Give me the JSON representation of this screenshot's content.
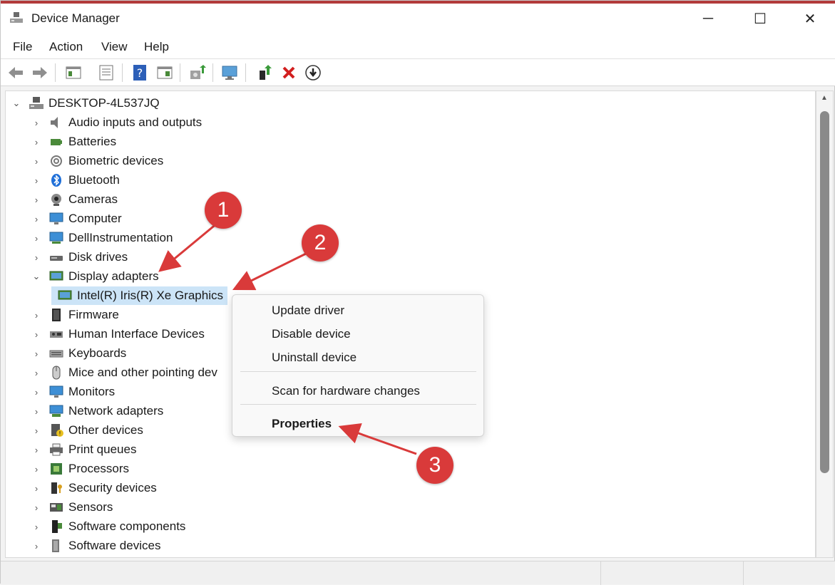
{
  "window": {
    "title": "Device Manager",
    "minimize_glyph": "─",
    "maximize_glyph": "☐",
    "close_glyph": "✕",
    "accent_color": "#d93a3a",
    "selection_color": "#cce4f7"
  },
  "menu": {
    "file": "File",
    "action": "Action",
    "view": "View",
    "help": "Help"
  },
  "toolbar": {
    "icons": [
      "back-arrow-icon",
      "forward-arrow-icon",
      "show-hide-tree-icon",
      "properties-icon",
      "help-icon",
      "action-pane-icon",
      "update-driver-icon",
      "scan-hardware-icon",
      "enable-device-icon",
      "uninstall-icon",
      "download-icon"
    ]
  },
  "tree": {
    "root": "DESKTOP-4L537JQ",
    "items": [
      {
        "label": "Audio inputs and outputs",
        "icon": "speaker-icon"
      },
      {
        "label": "Batteries",
        "icon": "battery-icon"
      },
      {
        "label": "Biometric devices",
        "icon": "fingerprint-icon"
      },
      {
        "label": "Bluetooth",
        "icon": "bluetooth-icon"
      },
      {
        "label": "Cameras",
        "icon": "camera-icon"
      },
      {
        "label": "Computer",
        "icon": "computer-icon"
      },
      {
        "label": "DellInstrumentation",
        "icon": "network-monitor-icon"
      },
      {
        "label": "Disk drives",
        "icon": "disk-drive-icon"
      },
      {
        "label": "Display adapters",
        "icon": "display-adapter-icon"
      },
      {
        "label": "Intel(R) Iris(R) Xe Graphics",
        "icon": "display-adapter-icon"
      },
      {
        "label": "Firmware",
        "icon": "chip-icon"
      },
      {
        "label": "Human Interface Devices",
        "icon": "hid-icon"
      },
      {
        "label": "Keyboards",
        "icon": "keyboard-icon"
      },
      {
        "label": "Mice and other pointing dev",
        "icon": "mouse-icon"
      },
      {
        "label": "Monitors",
        "icon": "monitor-icon"
      },
      {
        "label": "Network adapters",
        "icon": "network-adapter-icon"
      },
      {
        "label": "Other devices",
        "icon": "unknown-device-icon"
      },
      {
        "label": "Print queues",
        "icon": "printer-icon"
      },
      {
        "label": "Processors",
        "icon": "processor-icon"
      },
      {
        "label": "Security devices",
        "icon": "security-key-icon"
      },
      {
        "label": "Sensors",
        "icon": "sensor-icon"
      },
      {
        "label": "Software components",
        "icon": "software-component-icon"
      },
      {
        "label": "Software devices",
        "icon": "software-device-icon"
      }
    ]
  },
  "context_menu": {
    "update_driver": "Update driver",
    "disable_device": "Disable device",
    "uninstall_device": "Uninstall device",
    "scan_hardware": "Scan for hardware changes",
    "properties": "Properties"
  },
  "annotations": {
    "badge_1": "1",
    "badge_2": "2",
    "badge_3": "3"
  }
}
